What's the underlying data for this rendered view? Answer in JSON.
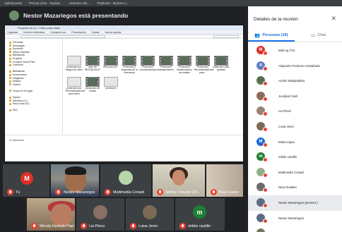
{
  "browser": {
    "bookmarks": [
      "Aplicaciones",
      "Prensa Libre - Noticia...",
      "Noticiero del...",
      "Traductor - Buscar C..."
    ]
  },
  "presenter": {
    "label": "Nestor Mazariegos está presentando"
  },
  "shared_screen": {
    "window_title": "Proyecto de p1 / Video para clase",
    "toolbar": [
      "Organizar",
      "Incluir en biblioteca",
      "Compartir con",
      "Presentación",
      "Grabar",
      "Nueva carpeta"
    ],
    "tree": [
      "Favoritos",
      "Descargas",
      "Escritorio",
      "Sitios recientes",
      "Bibliotecas",
      "Dropbox",
      "Creative Cloud Files",
      "OneDrive",
      "",
      "Bibliotecas",
      "Documentos",
      "Imágenes",
      "Música",
      "Vídeos",
      "",
      "Grupo en el hogar",
      "",
      "Equipo",
      "Windows (C:)",
      "Disco local (D:)",
      "",
      "Red"
    ],
    "files": [
      "protección por riesgos de vidrio",
      "Valle RE BRIVIDOS/VIT",
      "Recuerdo de...",
      "Protección y Seguridad de la ceremonia",
      "Protección Concientizaciónes",
      "Protección Mantenimiento",
      "Protección Mantenimiento de cuidado",
      "Protección Recomendaciones para...",
      "protección para guantes",
      "protección por Recomendaciones para niños",
      "protección de ventas",
      "protección"
    ],
    "status": "12 elementos"
  },
  "tiles": {
    "tu": {
      "initial": "M",
      "name": "Tú"
    },
    "nestor": {
      "name": "Nestor Mazariegos"
    },
    "multimedia": {
      "name": "Multimedia Conadi"
    },
    "shirley": {
      "name": "Shirley Oriando Ch..."
    },
    "raul": {
      "name": "Raul Juarez"
    },
    "wendy": {
      "name": "Wendy Hurtado Pael"
    },
    "lia": {
      "name": "Lia Pérez"
    },
    "luisa": {
      "name": "Luisa Jerez"
    },
    "mildre": {
      "initial": "m",
      "name": "mildre castillo"
    }
  },
  "panel": {
    "title": "Detalles de la reunión",
    "tab_people": "Personas (18)",
    "tab_chat": "Chat",
    "participants": [
      {
        "initial": "M",
        "color": "#d93025",
        "name": "Mali Ap (Tú)"
      },
      {
        "initial": "A",
        "color": "#5e7ec4",
        "name": "Alejandro Perdomo Castañeda"
      },
      {
        "initial": "",
        "color": "#5b6e52",
        "name": "ALMG Sakapulteka"
      },
      {
        "initial": "",
        "color": "#8c6a5a",
        "name": "Jocabed Cash"
      },
      {
        "initial": "",
        "color": "#9a8270",
        "name": "Lia Pérez"
      },
      {
        "initial": "",
        "color": "#7b6a55",
        "name": "Luisa Jerez"
      },
      {
        "initial": "M",
        "color": "#1967d2",
        "name": "Maria Cajas"
      },
      {
        "initial": "m",
        "color": "#1e7e34",
        "name": "mildre castillo"
      },
      {
        "initial": "",
        "color": "#8fae8a",
        "name": "Multimedia Conadi"
      },
      {
        "initial": "",
        "color": "#6d6d6d",
        "name": "Nery Rosales"
      },
      {
        "initial": "",
        "color": "#5a6b86",
        "name": "Nestor Mazariegos (present.)"
      },
      {
        "initial": "",
        "color": "#5a6b86",
        "name": "Nestor Mazariegos"
      },
      {
        "initial": "",
        "color": "#6b7a5a",
        "name": "Nestor Mazariegos"
      }
    ]
  }
}
